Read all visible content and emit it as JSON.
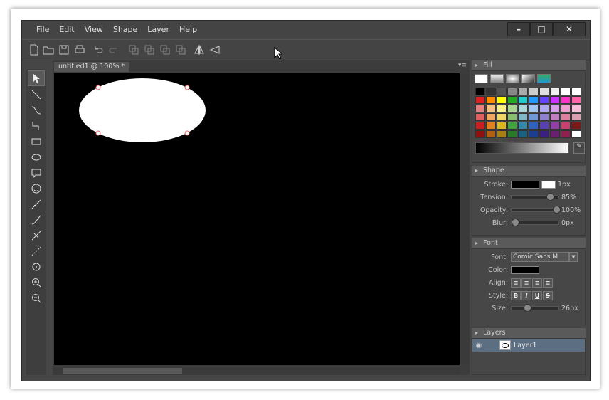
{
  "menu": [
    "File",
    "Edit",
    "View",
    "Shape",
    "Layer",
    "Help"
  ],
  "window": {
    "minimize": "–",
    "maximize": "□",
    "close": "✕"
  },
  "document": {
    "tab_label": "untitled1 @ 100% *"
  },
  "panels": {
    "fill": {
      "title": "Fill"
    },
    "shape": {
      "title": "Shape",
      "stroke_label": "Stroke:",
      "stroke_value": "1px",
      "tension_label": "Tension:",
      "tension_value": "85%",
      "tension_level": 0.85,
      "opacity_label": "Opacity:",
      "opacity_value": "100%",
      "opacity_level": 1.0,
      "blur_label": "Blur:",
      "blur_value": "0px",
      "blur_level": 0.0
    },
    "font": {
      "title": "Font",
      "font_label": "Font:",
      "font_value": "Comic Sans M",
      "color_label": "Color:",
      "align_label": "Align:",
      "style_label": "Style:",
      "bold": "B",
      "italic": "I",
      "underline": "U",
      "strike": "S",
      "size_label": "Size:",
      "size_value": "26px",
      "size_level": 0.3
    },
    "layers": {
      "title": "Layers",
      "items": [
        {
          "name": "Layer1"
        }
      ]
    }
  },
  "palette_colors": [
    "#000000",
    "#333333",
    "#555555",
    "#888888",
    "#aaaaaa",
    "#cccccc",
    "#e0e0e0",
    "#f0f0f0",
    "#ffffff",
    "#ffffff",
    "#e02020",
    "#ff8c00",
    "#ffff00",
    "#22aa22",
    "#22cccc",
    "#2299ff",
    "#6644ff",
    "#cc33ff",
    "#ff33cc",
    "#ff66aa",
    "#e88080",
    "#f8c080",
    "#f8f080",
    "#a8d890",
    "#a8d8d8",
    "#a0c8f0",
    "#b0a8f0",
    "#d8a0e8",
    "#f0a0d0",
    "#f8c0d8",
    "#e06060",
    "#f0a860",
    "#f0d860",
    "#88c070",
    "#80b8c8",
    "#7098d8",
    "#9080d0",
    "#c080c0",
    "#e080a0",
    "#d8a0b0",
    "#c82020",
    "#e08020",
    "#d8b820",
    "#44a040",
    "#3888a8",
    "#3060c0",
    "#5840b0",
    "#9040a0",
    "#c84070",
    "#7a1a1a",
    "#901010",
    "#b06010",
    "#a88010",
    "#2a7a2a",
    "#1a6080",
    "#1a3e90",
    "#3a2080",
    "#6a2070",
    "#902050",
    "#ffffff"
  ],
  "accent_colors": {
    "canvas": "#000000",
    "shape_fill": "#ffffff",
    "handle": "#e06060",
    "layer_selected": "#5c6e82"
  }
}
